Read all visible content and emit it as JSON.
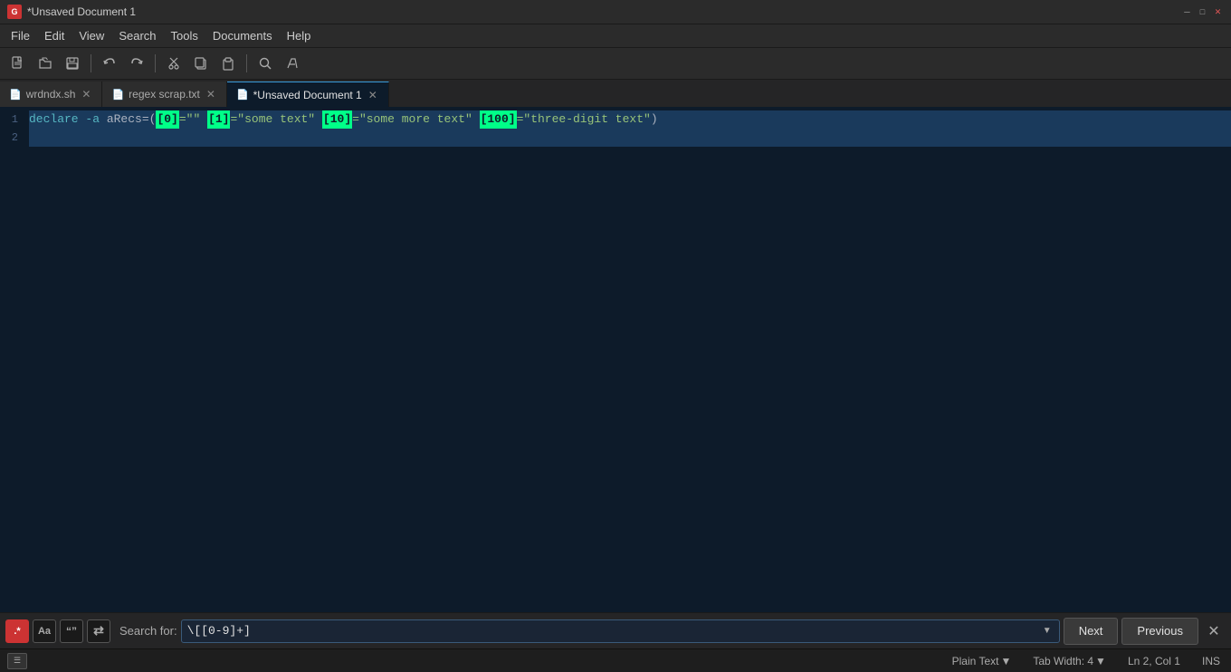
{
  "window": {
    "title": "*Unsaved Document 1",
    "app_icon": "G"
  },
  "menu": {
    "items": [
      "File",
      "Edit",
      "View",
      "Search",
      "Tools",
      "Documents",
      "Help"
    ]
  },
  "toolbar": {
    "buttons": [
      {
        "name": "new-file",
        "icon": "📄"
      },
      {
        "name": "open-file",
        "icon": "📂"
      },
      {
        "name": "save-file",
        "icon": "💾"
      },
      {
        "name": "undo",
        "icon": "↩"
      },
      {
        "name": "redo",
        "icon": "↪"
      },
      {
        "name": "cut",
        "icon": "✂"
      },
      {
        "name": "copy",
        "icon": "⧉"
      },
      {
        "name": "paste",
        "icon": "📋"
      },
      {
        "name": "search",
        "icon": "🔍"
      },
      {
        "name": "color-pick",
        "icon": "🎨"
      }
    ]
  },
  "tabs": [
    {
      "id": "tab1",
      "icon": "sh",
      "label": "wrdndx.sh",
      "active": false
    },
    {
      "id": "tab2",
      "icon": "txt",
      "label": "regex scrap.txt",
      "active": false
    },
    {
      "id": "tab3",
      "icon": "doc",
      "label": "*Unsaved Document 1",
      "active": true
    }
  ],
  "editor": {
    "lines": [
      {
        "num": 1,
        "highlighted": true,
        "content": "declare -a aRecs=([0]=\"\" [1]=\"some text\" [10]=\"some more text\" [100]=\"three-digit text\")"
      },
      {
        "num": 2,
        "highlighted": false,
        "content": ""
      }
    ],
    "cursor_line": 2
  },
  "search_bar": {
    "regex_label": ".*",
    "case_label": "Aa",
    "word_label": "\"\"",
    "replace_label": "",
    "search_label": "Search for:",
    "search_value": "\\[[0-9]+]",
    "next_label": "Next",
    "prev_label": "Previous"
  },
  "status_bar": {
    "language": "Plain Text",
    "tab_width": "Tab Width: 4",
    "position": "Ln 2, Col 1",
    "mode": "INS",
    "panel_icon": "☰"
  }
}
